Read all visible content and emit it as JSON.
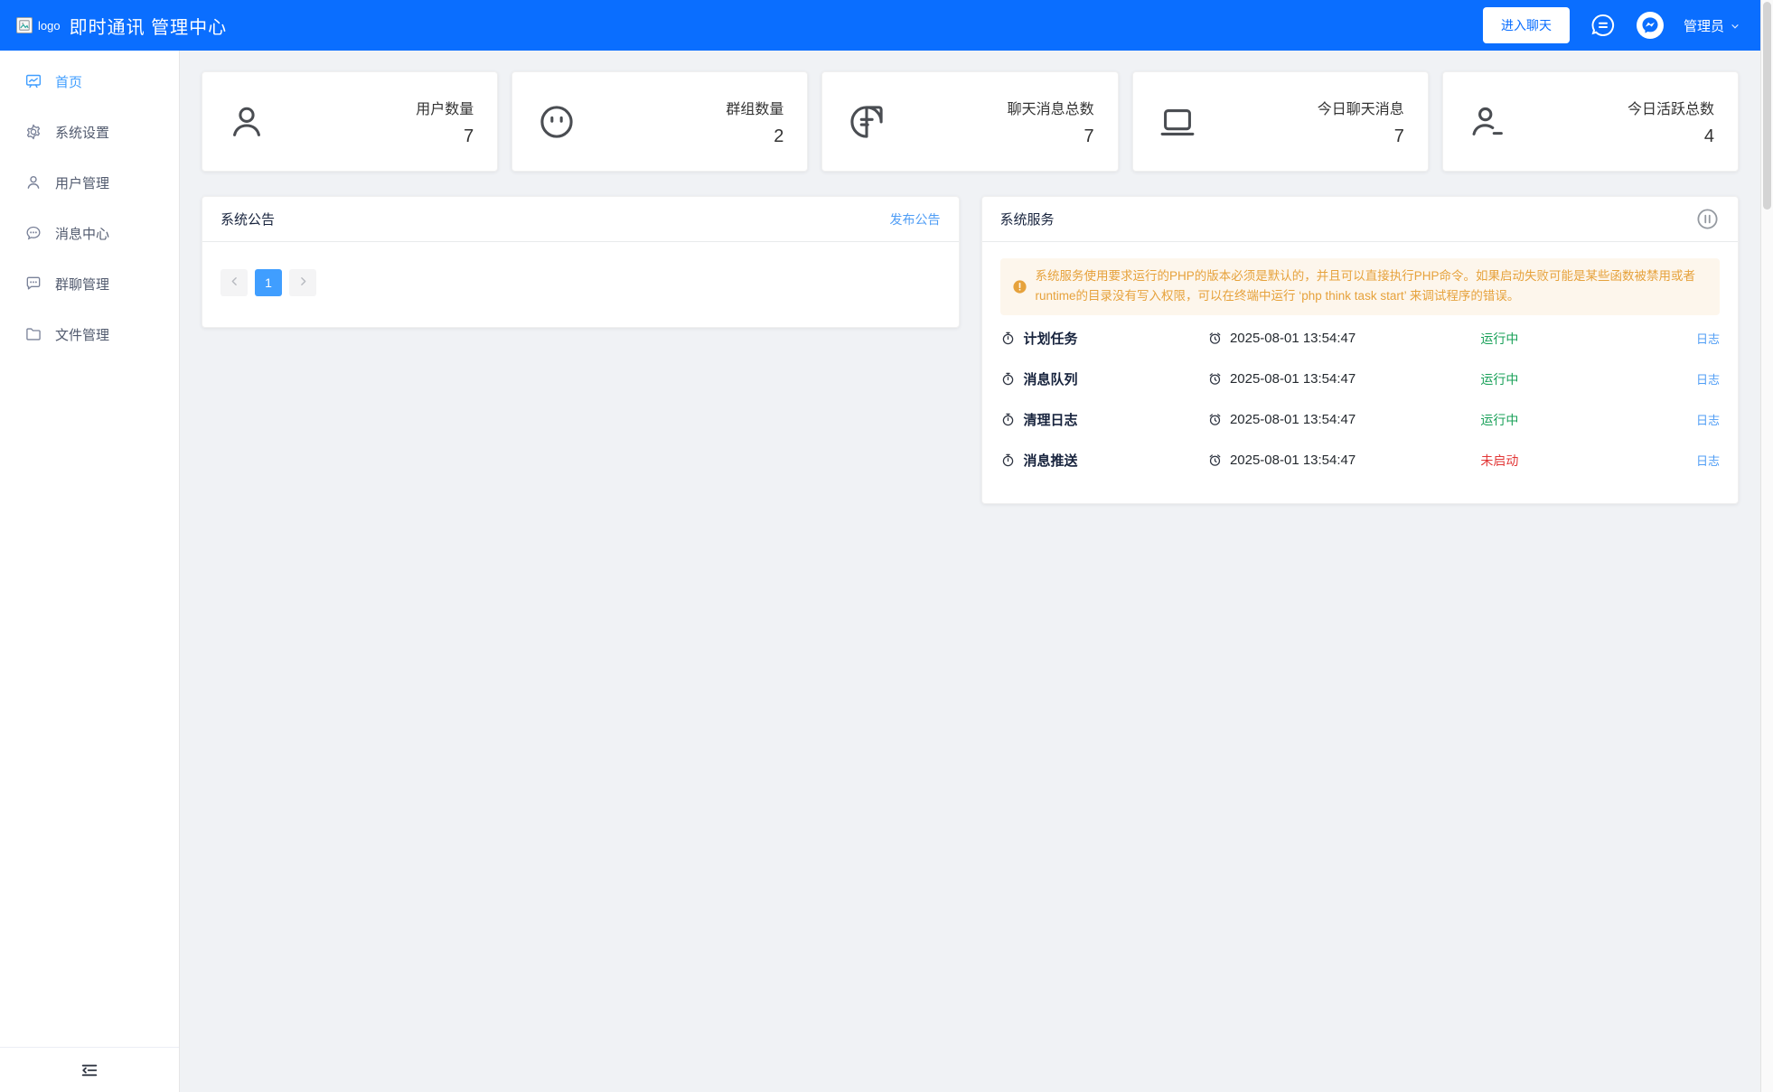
{
  "header": {
    "logo_alt": "logo",
    "title": "即时通讯 管理中心",
    "enter_chat_button": "进入聊天",
    "admin_label": "管理员",
    "icons": [
      "chat-bubble-icon",
      "messenger-avatar-icon",
      "chevron-down-icon"
    ]
  },
  "sidebar": {
    "items": [
      {
        "label": "首页",
        "icon": "dashboard-icon",
        "active": true
      },
      {
        "label": "系统设置",
        "icon": "gear-icon",
        "active": false
      },
      {
        "label": "用户管理",
        "icon": "user-icon",
        "active": false
      },
      {
        "label": "消息中心",
        "icon": "chat-round-icon",
        "active": false
      },
      {
        "label": "群聊管理",
        "icon": "chat-square-icon",
        "active": false
      },
      {
        "label": "文件管理",
        "icon": "folder-icon",
        "active": false
      }
    ],
    "footer_icon": "menu-fold-icon"
  },
  "stats": [
    {
      "label": "用户数量",
      "value": "7",
      "icon": "user-icon"
    },
    {
      "label": "群组数量",
      "value": "2",
      "icon": "face-icon"
    },
    {
      "label": "聊天消息总数",
      "value": "7",
      "icon": "chat-drop-icon"
    },
    {
      "label": "今日聊天消息",
      "value": "7",
      "icon": "laptop-icon"
    },
    {
      "label": "今日活跃总数",
      "value": "4",
      "icon": "user-check-icon"
    }
  ],
  "announcement_panel": {
    "title": "系统公告",
    "publish_link": "发布公告",
    "pagination": {
      "prev_icon": "chevron-left-icon",
      "current_page": "1",
      "next_icon": "chevron-right-icon"
    }
  },
  "service_panel": {
    "title": "系统服务",
    "header_icon": "pause-circle-icon",
    "warning": "系统服务使用要求运行的PHP的版本必须是默认的，并且可以直接执行PHP命令。如果启动失败可能是某些函数被禁用或者runtime的目录没有写入权限，可以在终端中运行 ‘php think task start’ 来调试程序的错误。",
    "log_label": "日志",
    "services": [
      {
        "name": "计划任务",
        "time": "2025-08-01 13:54:47",
        "status": "运行中"
      },
      {
        "name": "消息队列",
        "time": "2025-08-01 13:54:47",
        "status": "运行中"
      },
      {
        "name": "清理日志",
        "time": "2025-08-01 13:54:47",
        "status": "运行中"
      },
      {
        "name": "消息推送",
        "time": "2025-08-01 13:54:47",
        "status": "未启动"
      }
    ]
  },
  "colors": {
    "header_blue": "#0a6eff",
    "sidebar_active": "#409eff",
    "link_blue": "#4f9df5",
    "pagination_blue": "#409eff",
    "status_green": "#18a058",
    "status_red": "#e23636",
    "warning_bg": "#fdf6ec",
    "warning_text": "#e6a23c",
    "content_bg": "#f0f2f5"
  }
}
